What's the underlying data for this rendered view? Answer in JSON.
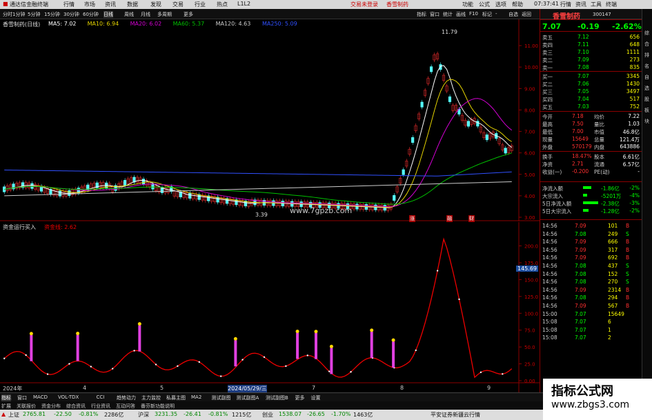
{
  "titlebar": {
    "app_title": "通达信金融终端",
    "menus": [
      "行情",
      "市场",
      "资讯",
      "数据",
      "发现",
      "交易",
      "行业",
      "热点",
      "L1L2"
    ],
    "center_left": "交易未登录",
    "center_right": "香雪制药",
    "right_menus": [
      "功能",
      "公式",
      "选项",
      "帮助"
    ],
    "time": "07:37:41",
    "right_tools": [
      "行情",
      "资讯",
      "工具",
      "终端"
    ]
  },
  "period_tabs": [
    "分时",
    "1分钟",
    "5分钟",
    "15分钟",
    "30分钟",
    "60分钟",
    "日线",
    "周线",
    "月线",
    "多周期",
    "更多"
  ],
  "toolbar_right": [
    "指标",
    "窗口",
    "统计",
    "画线",
    "F10",
    "标记",
    "-",
    "自选",
    "返回"
  ],
  "main_chart": {
    "stock_label": "香雪制药(日线)",
    "ma_labels": [
      {
        "text": "MA5: 7.02",
        "color": "#ffffff"
      },
      {
        "text": "MA10: 6.94",
        "color": "#e6d400"
      },
      {
        "text": "MA20: 6.02",
        "color": "#d400d4"
      },
      {
        "text": "MA60: 5.37",
        "color": "#00c000"
      },
      {
        "text": "MA120: 4.63",
        "color": "#cccccc"
      },
      {
        "text": "MA250: 5.09",
        "color": "#3050ff"
      }
    ],
    "price_ticks": [
      "11.00",
      "10.00",
      "9.00",
      "8.00",
      "7.00",
      "6.00",
      "5.00",
      "4.00",
      "3.00"
    ],
    "high_label": "11.79",
    "low_label": "3.39",
    "watermark": "www.7gpzb.com",
    "markers": [
      "涨",
      "融",
      "财"
    ]
  },
  "ind_chart": {
    "title": "资金运行买入",
    "value_label": "资金线: 2.62",
    "ticks": [
      "200.0",
      "175.0",
      "150.0",
      "125.0",
      "100.0",
      "75.0",
      "50.0",
      "25.0",
      "0.00"
    ],
    "current_value": "145.69",
    "date_labels": [
      "2024年",
      "4",
      "5",
      "2024/05/29/三",
      "7",
      "8",
      "9"
    ]
  },
  "quote": {
    "name": "香雪制药",
    "code": "300147",
    "price": "7.07",
    "change": "-0.19",
    "pct": "-2.62%",
    "asks": [
      {
        "label": "卖五",
        "price": "7.12",
        "vol": "656"
      },
      {
        "label": "卖四",
        "price": "7.11",
        "vol": "648"
      },
      {
        "label": "卖三",
        "price": "7.10",
        "vol": "1111"
      },
      {
        "label": "卖二",
        "price": "7.09",
        "vol": "273"
      },
      {
        "label": "卖一",
        "price": "7.08",
        "vol": "835"
      }
    ],
    "bids": [
      {
        "label": "买一",
        "price": "7.07",
        "vol": "3345"
      },
      {
        "label": "买二",
        "price": "7.06",
        "vol": "1430"
      },
      {
        "label": "买三",
        "price": "7.05",
        "vol": "3497"
      },
      {
        "label": "买四",
        "price": "7.04",
        "vol": "517"
      },
      {
        "label": "买五",
        "price": "7.03",
        "vol": "752"
      }
    ],
    "stats": [
      {
        "l1": "今开",
        "v1": "7.18",
        "l2": "均价",
        "v2": "7.22"
      },
      {
        "l1": "最高",
        "v1": "7.50",
        "l2": "量比",
        "v2": "1.03"
      },
      {
        "l1": "最低",
        "v1": "7.00",
        "l2": "市值",
        "v2": "46.8亿"
      },
      {
        "l1": "现量",
        "v1": "15649",
        "l2": "总量",
        "v2": "121.4万"
      },
      {
        "l1": "外盘",
        "v1": "570179",
        "l2": "内盘",
        "v2": "643886"
      }
    ],
    "stats2": [
      {
        "l1": "换手",
        "v1": "18.47%",
        "l2": "股本",
        "v2": "6.61亿"
      },
      {
        "l1": "净资",
        "v1": "2.71",
        "l2": "流通",
        "v2": "6.57亿"
      },
      {
        "l1": "收益(一)",
        "v1": "-0.200",
        "l2": "PE(动)",
        "v2": "-"
      }
    ],
    "flows": [
      {
        "label": "净流入额",
        "value": "-1.86亿",
        "bar": 0.3
      },
      {
        "label": "大宗流入",
        "value": "-5201万",
        "bar": 0.15
      },
      {
        "label": "5日净流入额",
        "value": "-2.38亿",
        "bar": 0.55
      },
      {
        "label": "5日大宗流入",
        "value": "-1.28亿",
        "bar": 0.2
      }
    ],
    "flow_pcts": [
      "-2%",
      "-4%",
      "-3%",
      "-2%"
    ],
    "ticks": [
      {
        "t": "14:56",
        "p": "7.09",
        "v": "101",
        "d": "B"
      },
      {
        "t": "14:56",
        "p": "7.08",
        "v": "249",
        "d": "S"
      },
      {
        "t": "14:56",
        "p": "7.09",
        "v": "666",
        "d": "B"
      },
      {
        "t": "14:56",
        "p": "7.09",
        "v": "317",
        "d": "B"
      },
      {
        "t": "14:56",
        "p": "7.09",
        "v": "692",
        "d": "B"
      },
      {
        "t": "14:56",
        "p": "7.08",
        "v": "437",
        "d": "S"
      },
      {
        "t": "14:56",
        "p": "7.08",
        "v": "152",
        "d": "S"
      },
      {
        "t": "14:56",
        "p": "7.08",
        "v": "270",
        "d": "S"
      },
      {
        "t": "14:56",
        "p": "7.09",
        "v": "2314",
        "d": "B"
      },
      {
        "t": "14:56",
        "p": "7.08",
        "v": "294",
        "d": "B"
      },
      {
        "t": "14:56",
        "p": "7.09",
        "v": "567",
        "d": "B"
      },
      {
        "t": "15:00",
        "p": "7.07",
        "v": "15649",
        "d": ""
      },
      {
        "t": "15:08",
        "p": "7.07",
        "v": "6",
        "d": ""
      },
      {
        "t": "15:08",
        "p": "7.07",
        "v": "1",
        "d": ""
      },
      {
        "t": "15:08",
        "p": "7.07",
        "v": "2",
        "d": ""
      }
    ]
  },
  "sidebar_labels": [
    "综",
    "合",
    "排",
    "名",
    "自",
    "选",
    "股",
    "板",
    "块"
  ],
  "bottom_tabs": [
    "指标",
    "窗口",
    "MACD",
    "VOL-TDX",
    "CCI",
    "趋势动力",
    "主力监控",
    "私募主图",
    "MA2",
    "测试副图",
    "测试副图A",
    "测试副图B",
    "更多",
    "设置"
  ],
  "bottom_tabs2": [
    "扩展",
    "关联报价",
    "资金分布",
    "综合资讯",
    "行业资讯",
    "互动问答",
    "番芬新功能说明"
  ],
  "status": {
    "sh_label": "上证",
    "sh_value": "2765.81",
    "sh_change": "-22.50",
    "sh_pct": "-0.81%",
    "sh_amt": "2286亿",
    "sz_label": "沪深",
    "sz_value": "3231.35",
    "sz_change": "-26.41",
    "sz_pct": "-0.81%",
    "sz_amt": "1215亿",
    "cy_label": "创业",
    "cy_value": "1538.07",
    "cy_change": "-26.65",
    "cy_pct": "-1.70%",
    "cy_amt": "1463亿",
    "broker": "平安证券新疆云行情"
  },
  "corner_watermark": {
    "line1": "指标公式网",
    "line2": "www.zbgs3.com"
  }
}
